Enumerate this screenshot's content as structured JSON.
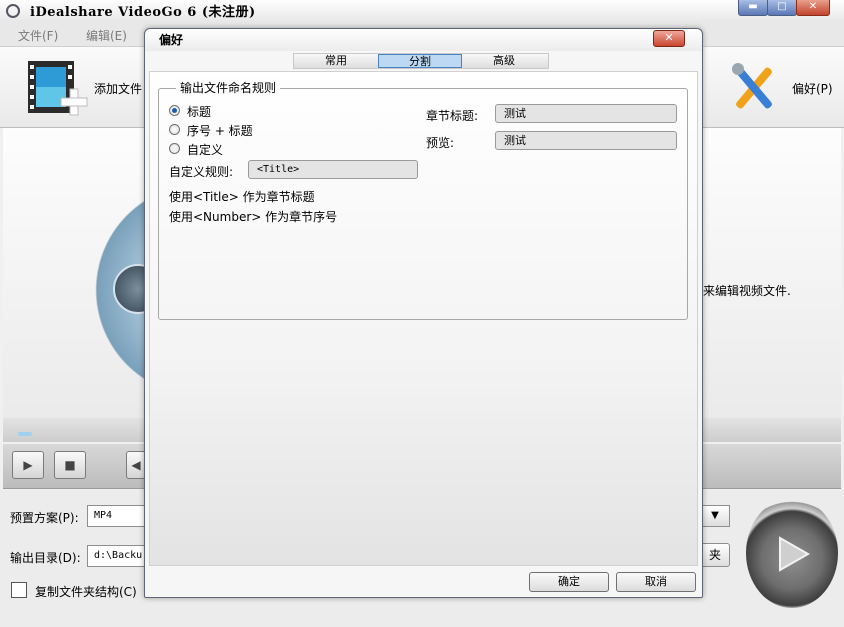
{
  "window": {
    "title": "iDealshare VideoGo 6 (未注册)"
  },
  "menu": {
    "file": "文件(F)",
    "edit": "编辑(E)"
  },
  "toolbar": {
    "add_file": "添加文件",
    "preferences": "偏好(P)",
    "hint_fragment": "来编辑视频文件."
  },
  "bottom": {
    "preset_label": "预置方案(P):",
    "preset_value": "MP4",
    "output_label": "输出目录(D):",
    "output_value": "d:\\Backu",
    "folder_btn_fragment": "夹",
    "copy_structure_label": "复制文件夹结构(C)"
  },
  "dialog": {
    "title": "偏好",
    "tabs": [
      {
        "label": "常用",
        "active": false
      },
      {
        "label": "分割",
        "active": true
      },
      {
        "label": "高级",
        "active": false
      }
    ],
    "group_title": "输出文件命名规则",
    "options": [
      {
        "label": "标题",
        "checked": true
      },
      {
        "label": "序号 + 标题",
        "checked": false
      },
      {
        "label": "自定义",
        "checked": false
      }
    ],
    "custom_rule_label": "自定义规则:",
    "custom_rule_value": "<Title>",
    "hint_title": "使用<Title> 作为章节标题",
    "hint_number": "使用<Number> 作为章节序号",
    "chapter_title_label": "章节标题:",
    "chapter_title_value": "测试",
    "preview_label": "预览:",
    "preview_value": "测试",
    "ok_label": "确定",
    "cancel_label": "取消"
  }
}
